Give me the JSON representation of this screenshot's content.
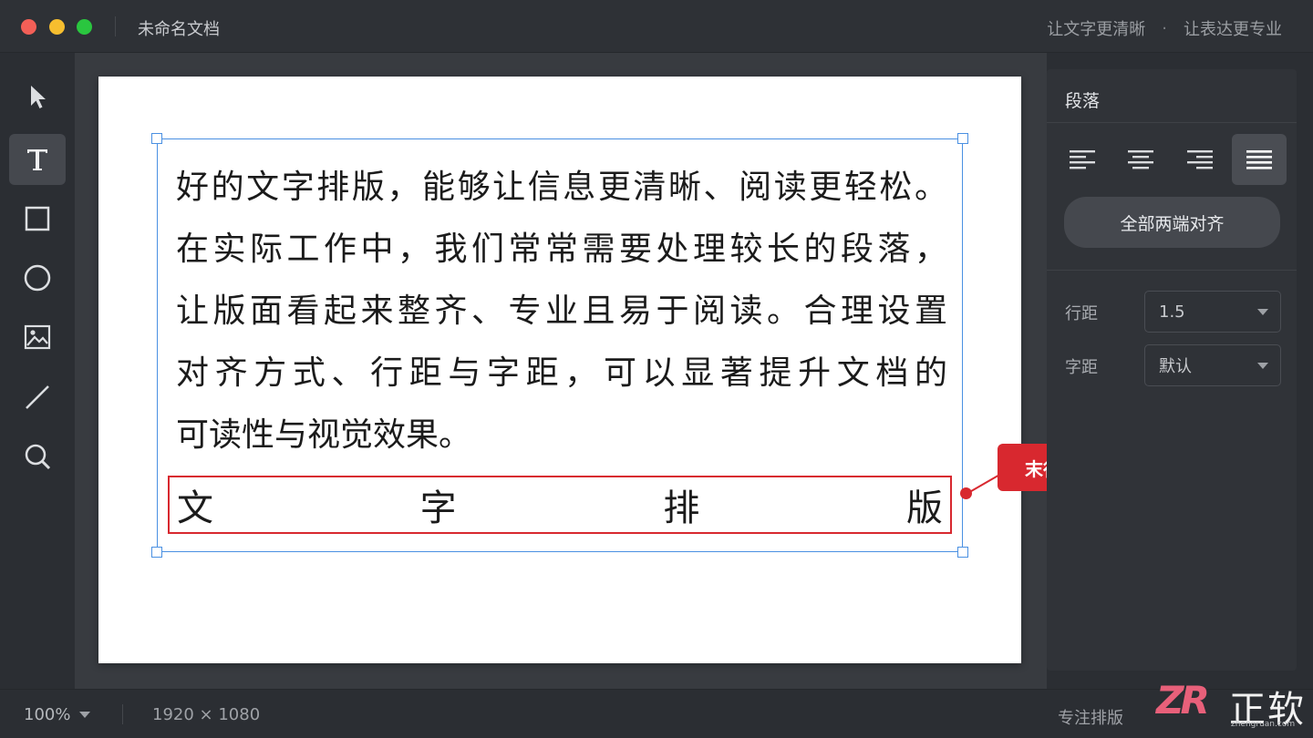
{
  "window": {
    "title": "未命名文档",
    "tagline": [
      "让文字更清晰",
      "·",
      "让表达更专业"
    ]
  },
  "toolbar": {
    "tools": [
      {
        "name": "select-tool",
        "icon": "cursor-icon",
        "active": false
      },
      {
        "name": "text-tool",
        "icon": "text-icon",
        "active": true
      },
      {
        "name": "rectangle-tool",
        "icon": "square-icon",
        "active": false
      },
      {
        "name": "ellipse-tool",
        "icon": "circle-icon",
        "active": false
      },
      {
        "name": "image-tool",
        "icon": "image-icon",
        "active": false
      },
      {
        "name": "line-tool",
        "icon": "line-icon",
        "active": false
      },
      {
        "name": "zoom-tool",
        "icon": "magnifier-icon",
        "active": false
      }
    ]
  },
  "document": {
    "lines": [
      "好的文字排版，能够让信息更清晰、阅读更轻松。",
      "在实际工作中，我们常常需要处理较长的段落，",
      "让版面看起来整齐、专业且易于阅读。合理设置",
      "对齐方式、行距与字距，可以显著提升文档的",
      "可读性与视觉效果。"
    ],
    "last_line_chars": [
      "文",
      "字",
      "排",
      "版"
    ],
    "callout": "末行被拉开"
  },
  "panel": {
    "title": "段落",
    "align_options": [
      {
        "name": "align-left",
        "active": false
      },
      {
        "name": "align-center",
        "active": false
      },
      {
        "name": "align-right",
        "active": false
      },
      {
        "name": "align-justify",
        "active": true
      }
    ],
    "justify_all_label": "全部两端对齐",
    "line_spacing_label": "行距",
    "line_spacing_value": "1.5",
    "letter_spacing_label": "字距",
    "letter_spacing_value": "默认"
  },
  "status": {
    "zoom": "100%",
    "dimensions": "1920 × 1080",
    "mode": "专注排版"
  },
  "watermark": {
    "logo": "ZR",
    "name": "正软",
    "url": "zhengruan.com"
  },
  "colors": {
    "accent_red": "#d8282f",
    "selection_blue": "#4a90e2"
  }
}
